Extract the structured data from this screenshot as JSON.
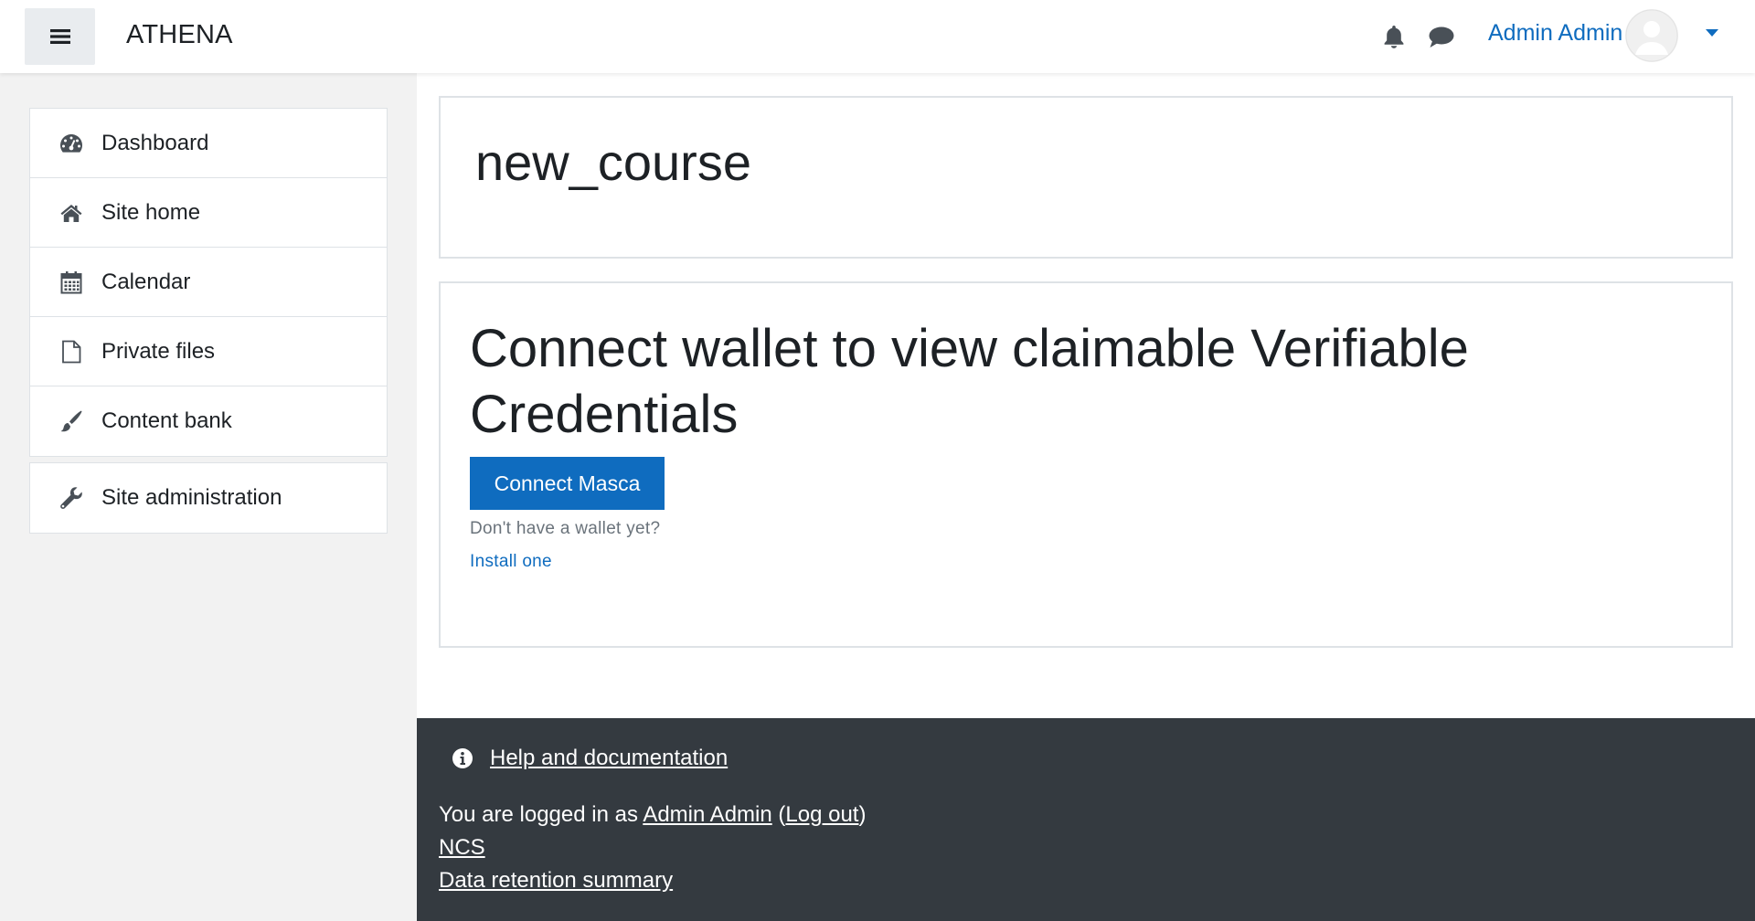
{
  "navbar": {
    "brand": "ATHENA",
    "user_name": "Admin Admin",
    "icons": {
      "menu": "hamburger-menu-icon",
      "notifications": "bell-icon",
      "messages": "chat-bubble-icon",
      "user_menu": "caret-down-icon"
    },
    "colors": {
      "accent": "#0f6cbf"
    }
  },
  "sidebar": {
    "items": [
      {
        "label": "Dashboard",
        "icon": "dashboard-gauge-icon"
      },
      {
        "label": "Site home",
        "icon": "home-icon"
      },
      {
        "label": "Calendar",
        "icon": "calendar-icon"
      },
      {
        "label": "Private files",
        "icon": "file-icon"
      },
      {
        "label": "Content bank",
        "icon": "paintbrush-icon"
      }
    ],
    "admin_item": {
      "label": "Site administration",
      "icon": "wrench-icon"
    }
  },
  "main": {
    "course_title": "new_course",
    "connect_card": {
      "heading": "Connect wallet to view claimable Verifiable Credentials",
      "button_label": "Connect Masca",
      "hint": "Don't have a wallet yet?",
      "install_link": "Install one"
    }
  },
  "footer": {
    "help_link": "Help and documentation",
    "help_icon": "info-circle-icon",
    "logged_in_prefix": "You are logged in as ",
    "logged_in_user": "Admin Admin",
    "open_paren": " (",
    "logout_link": "Log out",
    "close_paren": ")",
    "ncs_link": "NCS",
    "data_retention_link": "Data retention summary",
    "background": "#343a40"
  }
}
